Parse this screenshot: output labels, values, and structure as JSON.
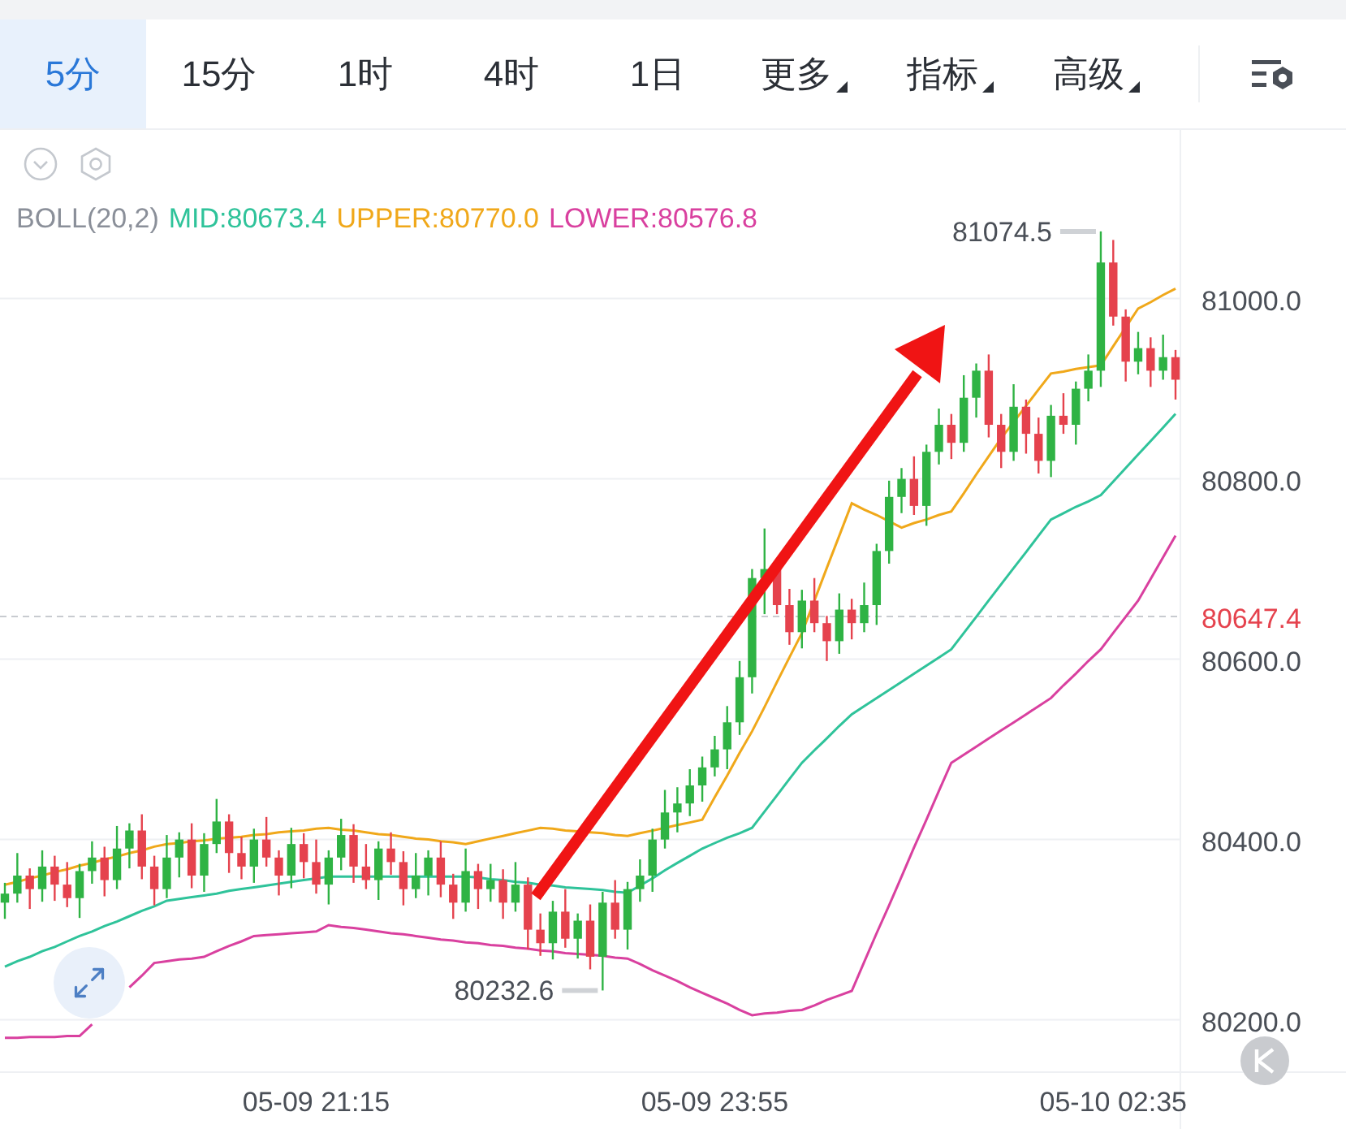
{
  "tabs": [
    {
      "label": "5分",
      "selected": true,
      "kind": "plain"
    },
    {
      "label": "15分",
      "selected": false,
      "kind": "plain"
    },
    {
      "label": "1时",
      "selected": false,
      "kind": "plain"
    },
    {
      "label": "4时",
      "selected": false,
      "kind": "plain"
    },
    {
      "label": "1日",
      "selected": false,
      "kind": "plain"
    },
    {
      "label": "更多",
      "selected": false,
      "kind": "dropdown"
    },
    {
      "label": "指标",
      "selected": false,
      "kind": "dropdown"
    },
    {
      "label": "高级",
      "selected": false,
      "kind": "dropdown"
    }
  ],
  "legend": [
    {
      "text": "BOLL(20,2)",
      "color": "#8a8f99"
    },
    {
      "text": "MID:80673.4",
      "color": "#2fc39a"
    },
    {
      "text": "UPPER:80770.0",
      "color": "#f0a81a"
    },
    {
      "text": "LOWER:80576.8",
      "color": "#d9409f"
    }
  ],
  "chart": {
    "chart_data": {
      "type": "candlestick",
      "ylim": [
        80142,
        81187
      ],
      "categories": [
        null,
        null,
        null,
        null,
        null,
        null,
        null,
        null,
        null,
        null,
        null,
        null,
        null,
        null,
        null,
        null,
        null,
        null,
        null,
        null,
        null,
        null,
        null,
        null,
        null,
        "05-09 21:15",
        null,
        null,
        null,
        null,
        null,
        null,
        null,
        null,
        null,
        null,
        null,
        null,
        null,
        null,
        null,
        null,
        null,
        null,
        null,
        null,
        null,
        null,
        null,
        null,
        null,
        null,
        null,
        null,
        null,
        null,
        null,
        "05-09 23:55",
        null,
        null,
        null,
        null,
        null,
        null,
        null,
        null,
        null,
        null,
        null,
        null,
        null,
        null,
        null,
        null,
        null,
        null,
        null,
        null,
        null,
        null,
        null,
        null,
        null,
        null,
        null,
        null,
        null,
        null,
        null,
        "05-10 02:35",
        null,
        null,
        null,
        null,
        null
      ],
      "series": [
        {
          "type": "line",
          "color": "#f0a81a",
          "values": [
            80350,
            80353,
            80357,
            80360,
            80364,
            80367,
            80371,
            80374,
            80378,
            80381,
            80385,
            80388,
            80392,
            80395,
            80396,
            80398,
            80399,
            80401,
            80402,
            80403,
            80405,
            80406,
            80408,
            80409,
            80410,
            80412,
            80413,
            80411,
            80410,
            80408,
            80406,
            80405,
            80403,
            80401,
            80400,
            80398,
            80397,
            80395,
            80398,
            80401,
            80404,
            80407,
            80410,
            80413,
            80412,
            80410,
            80409,
            80408,
            80407,
            80405,
            80404,
            80407,
            80410,
            80413,
            80416,
            80419,
            80422,
            80447,
            80471,
            80496,
            80520,
            80547,
            80575,
            80602,
            80629,
            80665,
            80701,
            80737,
            80773,
            80766,
            80760,
            80753,
            80746,
            80751,
            80755,
            80760,
            80764,
            80784,
            80805,
            80825,
            80845,
            80863,
            80881,
            80899,
            80917,
            80919,
            80922,
            80924,
            80926,
            80947,
            80968,
            80989,
            80996,
            81004,
            81011
          ]
        },
        {
          "type": "line",
          "color": "#2fc39a",
          "values": [
            80259,
            80265,
            80270,
            80276,
            80281,
            80287,
            80293,
            80298,
            80304,
            80309,
            80315,
            80321,
            80326,
            80332,
            80334,
            80336,
            80338,
            80340,
            80343,
            80345,
            80347,
            80349,
            80351,
            80353,
            80355,
            80357,
            80359,
            80359,
            80359,
            80359,
            80359,
            80359,
            80359,
            80359,
            80359,
            80359,
            80359,
            80359,
            80358,
            80356,
            80355,
            80353,
            80352,
            80350,
            80349,
            80347,
            80346,
            80345,
            80344,
            80342,
            80341,
            80349,
            80357,
            80366,
            80374,
            80382,
            80390,
            80396,
            80402,
            80407,
            80413,
            80431,
            80449,
            80467,
            80485,
            80499,
            80512,
            80526,
            80539,
            80548,
            80557,
            80566,
            80575,
            80584,
            80593,
            80602,
            80611,
            80629,
            80647,
            80665,
            80683,
            80701,
            80719,
            80737,
            80755,
            80762,
            80769,
            80775,
            80782,
            80797,
            80812,
            80827,
            80842,
            80857,
            80872
          ]
        },
        {
          "type": "line",
          "color": "#d9409f",
          "values": [
            80180,
            80180,
            80181,
            80181,
            80181,
            80182,
            80182,
            80195,
            null,
            null,
            80236,
            80249,
            80263,
            80265,
            80267,
            80268,
            80270,
            80276,
            80282,
            80287,
            80293,
            80294,
            80295,
            80296,
            80297,
            80298,
            80305,
            80303,
            80302,
            80300,
            80298,
            80296,
            80295,
            80293,
            80291,
            80289,
            80288,
            80286,
            80285,
            80283,
            80282,
            80280,
            80279,
            80277,
            80276,
            80274,
            80273,
            80272,
            80271,
            80269,
            80268,
            80262,
            80255,
            80249,
            80243,
            80236,
            80230,
            80224,
            80218,
            80211,
            80205,
            80207,
            80208,
            80210,
            80211,
            80216,
            80222,
            80227,
            80232,
            80264,
            80296,
            80327,
            80359,
            80391,
            80422,
            80454,
            80485,
            80494,
            80503,
            80512,
            80521,
            80530,
            80539,
            80548,
            80557,
            80571,
            80584,
            80598,
            80611,
            80629,
            80647,
            80665,
            80689,
            80713,
            80737
          ]
        }
      ],
      "yticks": [
        {
          "value": 80200,
          "label": "80200.0"
        },
        {
          "value": 80400,
          "label": "80400.0"
        },
        {
          "value": 80600,
          "label": "80600.0"
        },
        {
          "value": 80800,
          "label": "80800.0"
        },
        {
          "value": 81000,
          "label": "81000.0"
        }
      ],
      "ohlc": [
        [
          80330,
          80352,
          80312,
          80340
        ],
        [
          80340,
          80385,
          80330,
          80360
        ],
        [
          80360,
          80368,
          80323,
          80345
        ],
        [
          80345,
          80388,
          80331,
          80370
        ],
        [
          80370,
          80382,
          80332,
          80350
        ],
        [
          80350,
          80375,
          80325,
          80335
        ],
        [
          80335,
          80373,
          80313,
          80365
        ],
        [
          80365,
          80398,
          80351,
          80380
        ],
        [
          80380,
          80392,
          80337,
          80355
        ],
        [
          80355,
          80415,
          80345,
          80390
        ],
        [
          80390,
          80418,
          80368,
          80410
        ],
        [
          80410,
          80428,
          80356,
          80370
        ],
        [
          80370,
          80382,
          80327,
          80345
        ],
        [
          80345,
          80405,
          80335,
          80380
        ],
        [
          80380,
          80408,
          80358,
          80400
        ],
        [
          80400,
          80418,
          80346,
          80360
        ],
        [
          80360,
          80407,
          80342,
          80395
        ],
        [
          80395,
          80445,
          80385,
          80420
        ],
        [
          80420,
          80428,
          80363,
          80385
        ],
        [
          80385,
          80403,
          80356,
          80370
        ],
        [
          80370,
          80412,
          80352,
          80400
        ],
        [
          80400,
          80425,
          80370,
          80380
        ],
        [
          80380,
          80388,
          80338,
          80360
        ],
        [
          80360,
          80413,
          80346,
          80395
        ],
        [
          80395,
          80407,
          80357,
          80375
        ],
        [
          80375,
          80400,
          80340,
          80350
        ],
        [
          80350,
          80388,
          80328,
          80380
        ],
        [
          80380,
          80423,
          80366,
          80405
        ],
        [
          80405,
          80417,
          80352,
          80370
        ],
        [
          80370,
          80395,
          80345,
          80355
        ],
        [
          80355,
          80398,
          80333,
          80390
        ],
        [
          80390,
          80408,
          80361,
          80375
        ],
        [
          80375,
          80387,
          80327,
          80345
        ],
        [
          80345,
          80385,
          80335,
          80360
        ],
        [
          80360,
          80388,
          80338,
          80380
        ],
        [
          80380,
          80398,
          80336,
          80350
        ],
        [
          80350,
          80362,
          80312,
          80330
        ],
        [
          80330,
          80390,
          80320,
          80365
        ],
        [
          80365,
          80373,
          80323,
          80345
        ],
        [
          80345,
          80373,
          80331,
          80355
        ],
        [
          80355,
          80367,
          80312,
          80330
        ],
        [
          80330,
          80375,
          80320,
          80350
        ],
        [
          80350,
          80358,
          80278,
          80300
        ],
        [
          80300,
          80318,
          80271,
          80285
        ],
        [
          80285,
          80332,
          80267,
          80320
        ],
        [
          80320,
          80345,
          80280,
          80290
        ],
        [
          80290,
          80318,
          80268,
          80310
        ],
        [
          80310,
          80328,
          80256,
          80270
        ],
        [
          80270,
          80342,
          80232.6,
          80330
        ],
        [
          80330,
          80355,
          80290,
          80300
        ],
        [
          80300,
          80353,
          80278,
          80345
        ],
        [
          80345,
          80378,
          80331,
          80360
        ],
        [
          80360,
          80412,
          80342,
          80400
        ],
        [
          80400,
          80455,
          80390,
          80430
        ],
        [
          80430,
          80458,
          80408,
          80440
        ],
        [
          80440,
          80478,
          80426,
          80460
        ],
        [
          80460,
          80492,
          80442,
          80480
        ],
        [
          80480,
          80515,
          80470,
          80500
        ],
        [
          80500,
          80548,
          80478,
          80530
        ],
        [
          80530,
          80598,
          80516,
          80580
        ],
        [
          80580,
          80700,
          80562,
          80690
        ],
        [
          80690,
          80745,
          80650,
          80700
        ],
        [
          80700,
          80708,
          80650,
          80660
        ],
        [
          80660,
          80678,
          80616,
          80630
        ],
        [
          80630,
          80677,
          80612,
          80665
        ],
        [
          80665,
          80690,
          80630,
          80640
        ],
        [
          80640,
          80648,
          80598,
          80620
        ],
        [
          80620,
          80673,
          80606,
          80655
        ],
        [
          80655,
          80667,
          80622,
          80640
        ],
        [
          80640,
          80685,
          80630,
          80660
        ],
        [
          80660,
          80728,
          80638,
          80720
        ],
        [
          80720,
          80798,
          80706,
          80780
        ],
        [
          80780,
          80812,
          80762,
          80800
        ],
        [
          80800,
          80825,
          80760,
          80770
        ],
        [
          80770,
          80838,
          80748,
          80830
        ],
        [
          80830,
          80878,
          80816,
          80860
        ],
        [
          80860,
          80872,
          80822,
          80840
        ],
        [
          80840,
          80915,
          80830,
          80890
        ],
        [
          80890,
          80928,
          80868,
          80920
        ],
        [
          80920,
          80938,
          80846,
          80860
        ],
        [
          80860,
          80872,
          80812,
          80830
        ],
        [
          80830,
          80905,
          80820,
          80880
        ],
        [
          80880,
          80888,
          80828,
          80850
        ],
        [
          80850,
          80868,
          80806,
          80820
        ],
        [
          80820,
          80882,
          80802,
          80870
        ],
        [
          80870,
          80895,
          80850,
          80860
        ],
        [
          80860,
          80908,
          80838,
          80900
        ],
        [
          80900,
          80938,
          80886,
          80920
        ],
        [
          80920,
          81074.5,
          80902,
          81040
        ],
        [
          81040,
          81065,
          80970,
          80980
        ],
        [
          80980,
          80988,
          80908,
          80930
        ],
        [
          80930,
          80963,
          80916,
          80945
        ],
        [
          80945,
          80957,
          80902,
          80920
        ],
        [
          80920,
          80960,
          80910,
          80935
        ],
        [
          80935,
          80943,
          80888,
          80910
        ]
      ],
      "ref_lines": [
        {
          "axis": "y",
          "value": 80647.4,
          "label": "80647.4",
          "color": "#c8cbd0"
        }
      ],
      "grid": true,
      "annotations": [
        "81074.5",
        "80232.6"
      ]
    }
  }
}
